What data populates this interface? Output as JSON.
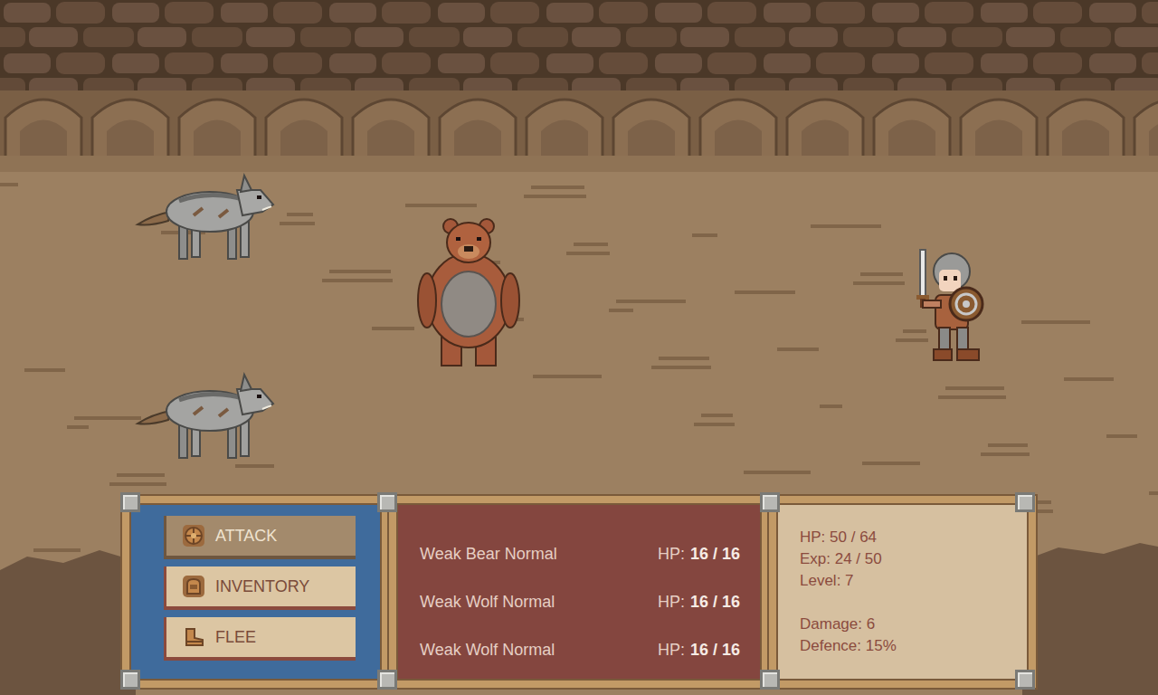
{
  "menu": [
    {
      "label": "ATTACK",
      "kind": "attack",
      "selected": true
    },
    {
      "label": "INVENTORY",
      "kind": "inventory",
      "selected": false
    },
    {
      "label": "FLEE",
      "kind": "flee",
      "selected": false
    }
  ],
  "enemies": [
    {
      "name": "Weak Bear Normal",
      "kind": "bear",
      "hp_label": "HP:",
      "hp": "16 / 16"
    },
    {
      "name": "Weak Wolf Normal",
      "kind": "wolf",
      "hp_label": "HP:",
      "hp": "16 / 16"
    },
    {
      "name": "Weak Wolf Normal",
      "kind": "wolf",
      "hp_label": "HP:",
      "hp": "16 / 16"
    }
  ],
  "player": {
    "stat_groups": [
      [
        "HP: 50 / 64",
        "Exp: 24 / 50",
        "Level: 7"
      ],
      [
        "Damage: 6",
        "Defence: 15%"
      ]
    ]
  }
}
